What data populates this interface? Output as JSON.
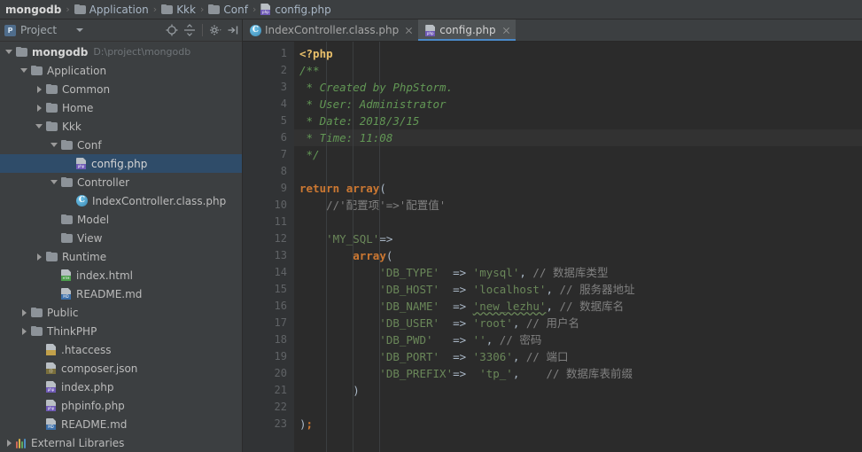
{
  "breadcrumb": {
    "items": [
      {
        "label": "mongodb",
        "icon": "none"
      },
      {
        "label": "Application",
        "icon": "folder-icon"
      },
      {
        "label": "Kkk",
        "icon": "folder-icon"
      },
      {
        "label": "Conf",
        "icon": "folder-icon"
      },
      {
        "label": "config.php",
        "icon": "php-file-icon"
      }
    ],
    "separator": "›"
  },
  "project_panel": {
    "title": "Project",
    "badge": "P",
    "toolbar_buttons": [
      {
        "name": "scroll-from-source-icon",
        "glyph": "⊕"
      },
      {
        "name": "collapse-all-icon",
        "glyph": "⇹"
      },
      {
        "name": "settings-gear-icon",
        "glyph": "⚙"
      },
      {
        "name": "hide-panel-icon",
        "glyph": "⇥"
      }
    ],
    "tree": [
      {
        "label": "mongodb",
        "hint": "D:\\project\\mongodb",
        "depth": 0,
        "arrow": "open",
        "icon": "folder-icon",
        "bold": true,
        "selected": false
      },
      {
        "label": "Application",
        "hint": "",
        "depth": 1,
        "arrow": "open",
        "icon": "folder-icon",
        "bold": false,
        "selected": false
      },
      {
        "label": "Common",
        "hint": "",
        "depth": 2,
        "arrow": "closed",
        "icon": "folder-icon",
        "bold": false,
        "selected": false
      },
      {
        "label": "Home",
        "hint": "",
        "depth": 2,
        "arrow": "closed",
        "icon": "folder-icon",
        "bold": false,
        "selected": false
      },
      {
        "label": "Kkk",
        "hint": "",
        "depth": 2,
        "arrow": "open",
        "icon": "folder-icon",
        "bold": false,
        "selected": false
      },
      {
        "label": "Conf",
        "hint": "",
        "depth": 3,
        "arrow": "open",
        "icon": "folder-icon",
        "bold": false,
        "selected": false
      },
      {
        "label": "config.php",
        "hint": "",
        "depth": 4,
        "arrow": "none",
        "icon": "php-file-icon",
        "bold": false,
        "selected": true
      },
      {
        "label": "Controller",
        "hint": "",
        "depth": 3,
        "arrow": "open",
        "icon": "folder-icon",
        "bold": false,
        "selected": false
      },
      {
        "label": "IndexController.class.php",
        "hint": "",
        "depth": 4,
        "arrow": "none",
        "icon": "class-file-icon",
        "bold": false,
        "selected": false
      },
      {
        "label": "Model",
        "hint": "",
        "depth": 3,
        "arrow": "none",
        "icon": "folder-icon",
        "bold": false,
        "selected": false
      },
      {
        "label": "View",
        "hint": "",
        "depth": 3,
        "arrow": "none",
        "icon": "folder-icon",
        "bold": false,
        "selected": false
      },
      {
        "label": "Runtime",
        "hint": "",
        "depth": 2,
        "arrow": "closed",
        "icon": "folder-icon",
        "bold": false,
        "selected": false
      },
      {
        "label": "index.html",
        "hint": "",
        "depth": 3,
        "arrow": "none",
        "icon": "html-file-icon",
        "bold": false,
        "selected": false
      },
      {
        "label": "README.md",
        "hint": "",
        "depth": 3,
        "arrow": "none",
        "icon": "md-file-icon",
        "bold": false,
        "selected": false
      },
      {
        "label": "Public",
        "hint": "",
        "depth": 1,
        "arrow": "closed",
        "icon": "folder-icon",
        "bold": false,
        "selected": false
      },
      {
        "label": "ThinkPHP",
        "hint": "",
        "depth": 1,
        "arrow": "closed",
        "icon": "folder-icon",
        "bold": false,
        "selected": false
      },
      {
        "label": ".htaccess",
        "hint": "",
        "depth": 2,
        "arrow": "none",
        "icon": "htaccess-file-icon",
        "bold": false,
        "selected": false
      },
      {
        "label": "composer.json",
        "hint": "",
        "depth": 2,
        "arrow": "none",
        "icon": "json-file-icon",
        "bold": false,
        "selected": false
      },
      {
        "label": "index.php",
        "hint": "",
        "depth": 2,
        "arrow": "none",
        "icon": "php-file-icon",
        "bold": false,
        "selected": false
      },
      {
        "label": "phpinfo.php",
        "hint": "",
        "depth": 2,
        "arrow": "none",
        "icon": "php-file-icon",
        "bold": false,
        "selected": false
      },
      {
        "label": "README.md",
        "hint": "",
        "depth": 2,
        "arrow": "none",
        "icon": "md-file-icon",
        "bold": false,
        "selected": false
      },
      {
        "label": "External Libraries",
        "hint": "",
        "depth": 0,
        "arrow": "closed",
        "icon": "libraries-icon",
        "bold": false,
        "selected": false
      }
    ]
  },
  "editor": {
    "tabs": [
      {
        "label": "IndexController.class.php",
        "icon": "class-file-icon",
        "active": false
      },
      {
        "label": "config.php",
        "icon": "php-file-icon",
        "active": true
      }
    ],
    "current_line": 6,
    "line_numbers": [
      1,
      2,
      3,
      4,
      5,
      6,
      7,
      8,
      9,
      10,
      11,
      12,
      13,
      14,
      15,
      16,
      17,
      18,
      19,
      20,
      21,
      22,
      23
    ],
    "lines": [
      {
        "n": 1,
        "tokens": [
          {
            "t": "<?php",
            "c": "tagc"
          }
        ]
      },
      {
        "n": 2,
        "tokens": [
          {
            "t": "/**",
            "c": "doc"
          }
        ]
      },
      {
        "n": 3,
        "tokens": [
          {
            "t": " * Created by PhpStorm.",
            "c": "doc"
          }
        ]
      },
      {
        "n": 4,
        "tokens": [
          {
            "t": " * User: Administrator",
            "c": "doc"
          }
        ]
      },
      {
        "n": 5,
        "tokens": [
          {
            "t": " * Date: 2018/3/15",
            "c": "doc"
          }
        ]
      },
      {
        "n": 6,
        "tokens": [
          {
            "t": " * Time: 11:08",
            "c": "doc"
          }
        ]
      },
      {
        "n": 7,
        "tokens": [
          {
            "t": " */",
            "c": "doc"
          }
        ]
      },
      {
        "n": 8,
        "tokens": []
      },
      {
        "n": 9,
        "tokens": [
          {
            "t": "return",
            "c": "kw"
          },
          {
            "t": " ",
            "c": "op"
          },
          {
            "t": "array",
            "c": "kw"
          },
          {
            "t": "(",
            "c": "punct"
          }
        ]
      },
      {
        "n": 10,
        "tokens": [
          {
            "t": "    //'配置项'=>'配置值'",
            "c": "cmt"
          }
        ]
      },
      {
        "n": 11,
        "tokens": []
      },
      {
        "n": 12,
        "tokens": [
          {
            "t": "    'MY_SQL'",
            "c": "str"
          },
          {
            "t": "=>",
            "c": "op"
          }
        ]
      },
      {
        "n": 13,
        "tokens": [
          {
            "t": "        ",
            "c": "op"
          },
          {
            "t": "array",
            "c": "kw"
          },
          {
            "t": "(",
            "c": "punct"
          }
        ]
      },
      {
        "n": 14,
        "tokens": [
          {
            "t": "            'DB_TYPE'  ",
            "c": "str"
          },
          {
            "t": "=> ",
            "c": "op"
          },
          {
            "t": "'mysql'",
            "c": "str"
          },
          {
            "t": ", ",
            "c": "punct"
          },
          {
            "t": "// 数据库类型",
            "c": "cmt"
          }
        ]
      },
      {
        "n": 15,
        "tokens": [
          {
            "t": "            'DB_HOST'  ",
            "c": "str"
          },
          {
            "t": "=> ",
            "c": "op"
          },
          {
            "t": "'localhost'",
            "c": "str"
          },
          {
            "t": ", ",
            "c": "punct"
          },
          {
            "t": "// 服务器地址",
            "c": "cmt"
          }
        ]
      },
      {
        "n": 16,
        "tokens": [
          {
            "t": "            'DB_NAME'  ",
            "c": "str"
          },
          {
            "t": "=> ",
            "c": "op"
          },
          {
            "t": "'new_lezhu'",
            "c": "str typo"
          },
          {
            "t": ", ",
            "c": "punct"
          },
          {
            "t": "// 数据库名",
            "c": "cmt"
          }
        ]
      },
      {
        "n": 17,
        "tokens": [
          {
            "t": "            'DB_USER'  ",
            "c": "str"
          },
          {
            "t": "=> ",
            "c": "op"
          },
          {
            "t": "'root'",
            "c": "str"
          },
          {
            "t": ", ",
            "c": "punct"
          },
          {
            "t": "// 用户名",
            "c": "cmt"
          }
        ]
      },
      {
        "n": 18,
        "tokens": [
          {
            "t": "            'DB_PWD'   ",
            "c": "str"
          },
          {
            "t": "=> ",
            "c": "op"
          },
          {
            "t": "''",
            "c": "str"
          },
          {
            "t": ", ",
            "c": "punct"
          },
          {
            "t": "// 密码",
            "c": "cmt"
          }
        ]
      },
      {
        "n": 19,
        "tokens": [
          {
            "t": "            'DB_PORT'  ",
            "c": "str"
          },
          {
            "t": "=> ",
            "c": "op"
          },
          {
            "t": "'3306'",
            "c": "str"
          },
          {
            "t": ", ",
            "c": "punct"
          },
          {
            "t": "// 端口",
            "c": "cmt"
          }
        ]
      },
      {
        "n": 20,
        "tokens": [
          {
            "t": "            'DB_PREFIX'",
            "c": "str"
          },
          {
            "t": "=> ",
            "c": "op"
          },
          {
            "t": " 'tp_'",
            "c": "str"
          },
          {
            "t": ",    ",
            "c": "punct"
          },
          {
            "t": "// 数据库表前缀",
            "c": "cmt"
          }
        ]
      },
      {
        "n": 21,
        "tokens": [
          {
            "t": "        )",
            "c": "punct"
          }
        ]
      },
      {
        "n": 22,
        "tokens": []
      },
      {
        "n": 23,
        "tokens": [
          {
            "t": ")",
            "c": "punct"
          },
          {
            "t": ";",
            "c": "kw"
          }
        ]
      }
    ],
    "fold_markers": [
      {
        "line": 2,
        "type": "open"
      },
      {
        "line": 7,
        "type": "close"
      },
      {
        "line": 9,
        "type": "open"
      },
      {
        "line": 13,
        "type": "open"
      },
      {
        "line": 21,
        "type": "close"
      },
      {
        "line": 23,
        "type": "close"
      }
    ]
  },
  "colors": {
    "panel_bg": "#3c3f41",
    "editor_bg": "#2b2b2b",
    "gutter_bg": "#313335",
    "selection": "#2f4c69",
    "accent": "#4a88c7",
    "keyword": "#cc7832",
    "string": "#6a8759",
    "comment": "#808080",
    "docstring": "#629755",
    "text": "#a9b7c6"
  }
}
